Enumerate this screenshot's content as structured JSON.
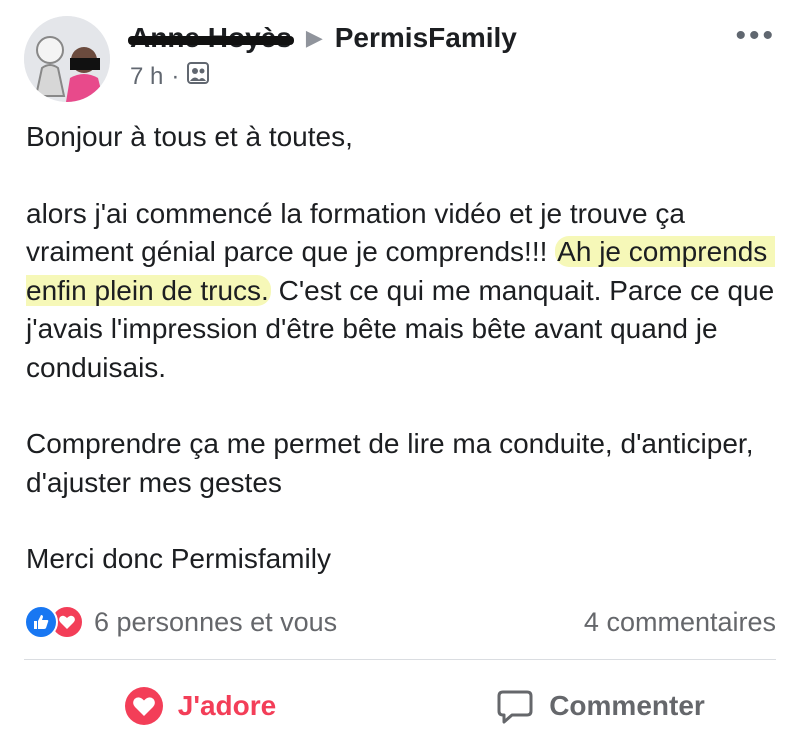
{
  "post": {
    "author_name": "Anne Hoyès",
    "group_name": "PermisFamily",
    "time": "7 h",
    "separator": "·",
    "paragraphs": [
      "Bonjour à tous et à toutes,",
      "alors j'ai commencé la formation vidéo et je trouve ça vraiment génial parce que je comprends!!! ",
      "Ah je comprends enfin plein de trucs.",
      " C'est ce qui me manquait. Parce ce que j'avais l'impression d'être bête mais bête avant quand je conduisais.",
      "Comprendre ça me permet de lire ma conduite, d'anticiper, d'ajuster mes gestes",
      "Merci donc Permisfamily"
    ]
  },
  "reactions": {
    "count_text": "6 personnes et vous",
    "comments_text": "4 commentaires",
    "like_color": "#1877f2",
    "love_color": "#f33e58"
  },
  "actions": {
    "love_label": "J'adore",
    "comment_label": "Commenter"
  },
  "icons": {
    "more": "more-horizontal-icon",
    "audience": "group-audience-icon",
    "arrow": "triangle-right-icon"
  }
}
